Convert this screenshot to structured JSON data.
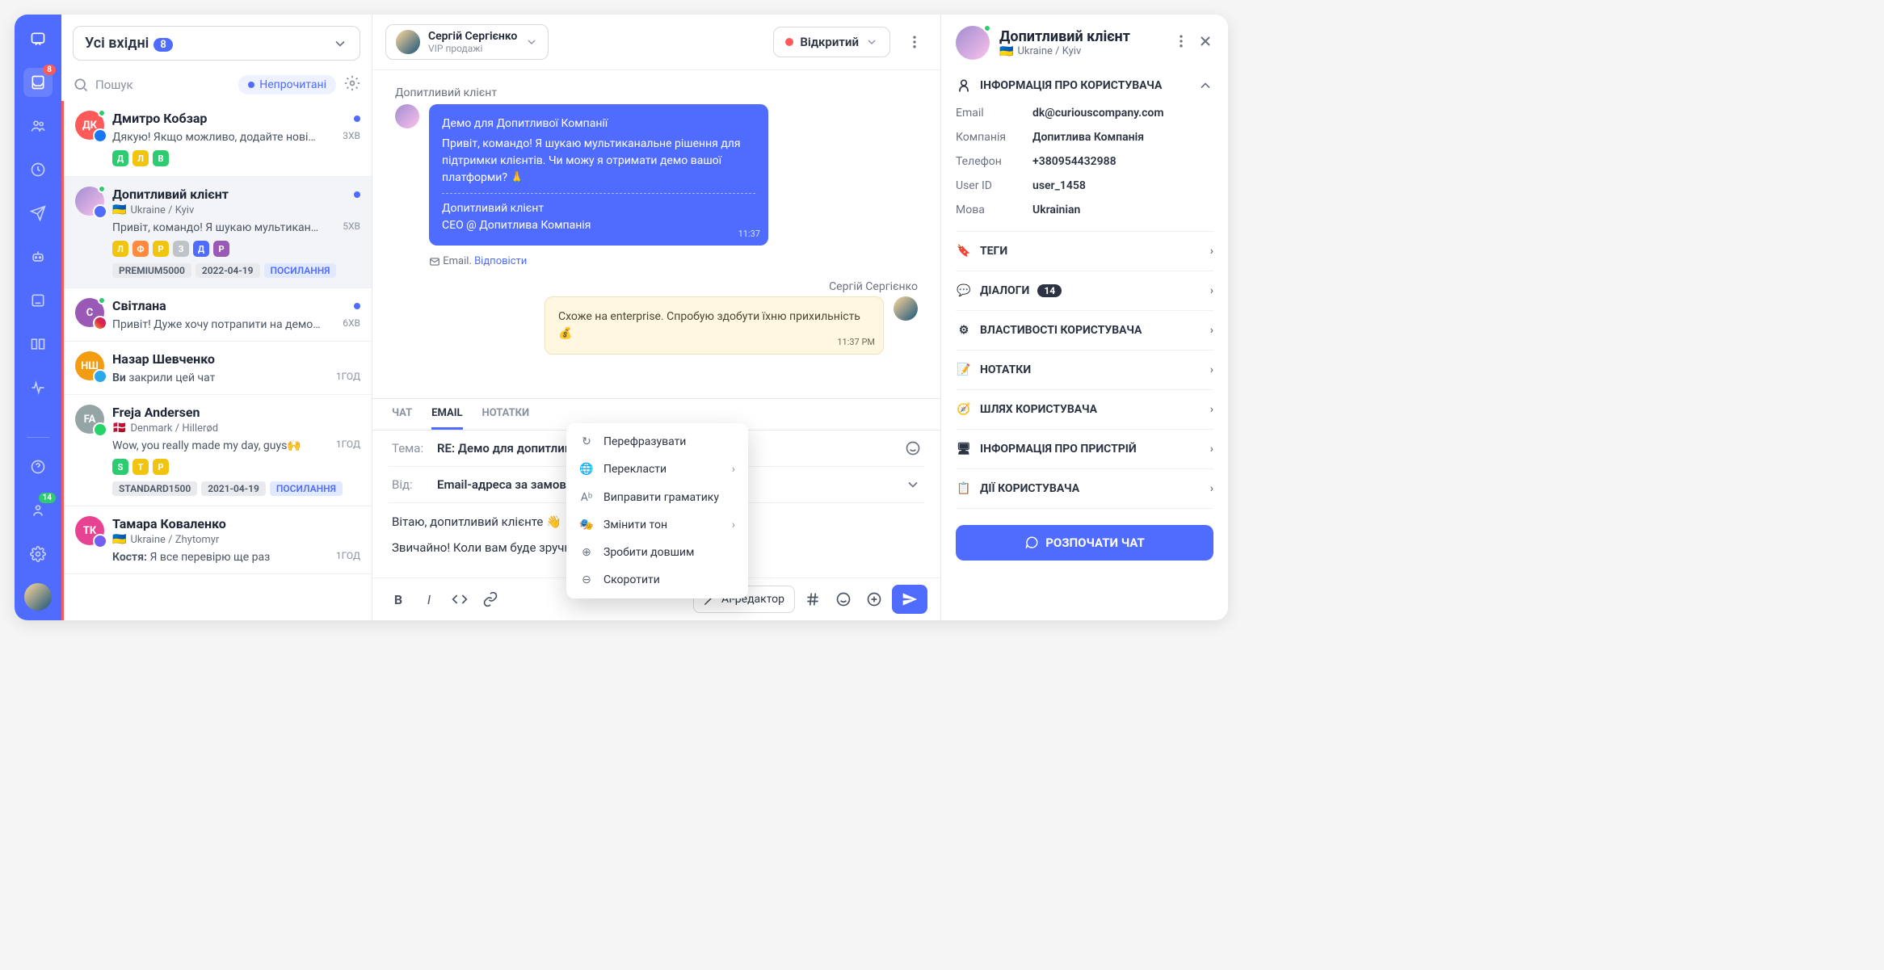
{
  "nav": {
    "inbox_badge": "8",
    "team_badge": "14"
  },
  "inbox": {
    "label": "Усі вхідні",
    "count": "8"
  },
  "search": {
    "placeholder": "Пошук",
    "filter": "Непрочитані"
  },
  "conversations": [
    {
      "name": "Дмитро Кобзар",
      "preview": "Дякую! Якщо можливо, додайте нові…",
      "time": "3ХВ",
      "initials": "ДК",
      "avatar_bg": "#ff5a5a",
      "channel_bg": "#1877f2",
      "online": true,
      "tags": [
        {
          "l": "Д",
          "c": "#2ecc71"
        },
        {
          "l": "Л",
          "c": "#f1c40f"
        },
        {
          "l": "В",
          "c": "#2ecc71"
        }
      ]
    },
    {
      "name": "Допитливий клієнт",
      "preview": "Привіт, командо! Я шукаю мультикан…",
      "time": "5ХВ",
      "loc": "Ukraine / Kyiv",
      "flag": "🇺🇦",
      "avatar_img": true,
      "channel_bg": "#4f6cff",
      "online": true,
      "tags": [
        {
          "l": "Л",
          "c": "#f1c40f"
        },
        {
          "l": "Ф",
          "c": "#ff8a3d"
        },
        {
          "l": "Р",
          "c": "#f1c40f"
        },
        {
          "l": "З",
          "c": "#bdc3c7"
        },
        {
          "l": "Д",
          "c": "#4f6cff"
        },
        {
          "l": "Р",
          "c": "#9b59b6"
        }
      ],
      "pills": [
        "PREMIUM5000",
        "2022-04-19"
      ],
      "link_pill": "ПОСИЛАННЯ",
      "selected": true
    },
    {
      "name": "Світлана",
      "preview": "Привіт! Дуже хочу потрапити на демо…",
      "time": "6ХВ",
      "initials": "С",
      "avatar_bg": "#9b59b6",
      "channel_bg": "linear-gradient(45deg,#f09433,#e6683c,#dc2743,#cc2366,#bc1888)",
      "online": true
    },
    {
      "name": "Назар Шевченко",
      "preview_prefix": "Ви ",
      "preview": "закрили цей чат",
      "time": "1ГОД",
      "initials": "НШ",
      "avatar_bg": "#f39c12",
      "channel_bg": "#29a9eb"
    },
    {
      "name": "Freja Andersen",
      "preview": "Wow, you really made my day, guys🙌",
      "time": "1ГОД",
      "initials": "FA",
      "avatar_bg": "#95a5a6",
      "channel_bg": "#25d366",
      "loc": "Denmark / Hillerød",
      "flag": "🇩🇰",
      "tags": [
        {
          "l": "S",
          "c": "#2ecc71"
        },
        {
          "l": "T",
          "c": "#f1c40f"
        },
        {
          "l": "P",
          "c": "#f1c40f"
        }
      ],
      "pills": [
        "STANDARD1500",
        "2021-04-19"
      ],
      "link_pill": "ПОСИЛАННЯ"
    },
    {
      "name": "Тамара Коваленко",
      "preview_prefix": "Костя: ",
      "preview": "Я все перевірю ще раз",
      "time": "1ГОД",
      "initials": "ТК",
      "avatar_bg": "#e84393",
      "channel_bg": "#7360f2",
      "loc": "Ukraine / Zhytomyr",
      "flag": "🇺🇦"
    }
  ],
  "chat_header": {
    "assignee_name": "Сергій Сергієнко",
    "assignee_role": "VIP продажі",
    "status": "Відкритий"
  },
  "messages": {
    "in_label": "Допитливий клієнт",
    "in_lines": [
      "Демо для Допитливої Компанії",
      "Привіт, командо! Я шукаю мультиканальне рішення для підтримки клієнтів. Чи можу я отримати демо вашої платформи? 🙏"
    ],
    "in_sig": [
      "Допитливий клієнт",
      "CEO @ Допитлива Компанія"
    ],
    "in_time": "11:37",
    "email_meta_prefix": "Email. ",
    "email_meta_link": "Відповісти",
    "out_label": "Сергій Сергієнко",
    "out_text": "Схоже на enterprise. Спробую здобути їхню прихильність 💰",
    "out_time": "11:37 PM"
  },
  "composer": {
    "tabs": [
      "ЧАТ",
      "EMAIL",
      "НОТАТКИ"
    ],
    "subject_label": "Тема:",
    "subject": "RE: Демо для допитливого к",
    "from_label": "Від:",
    "from": "Email-адреса за замовчуван",
    "body_line1": "Вітаю, допитливий клієнте 👋",
    "body_line2": "Звичайно! Коли вам буде зручно?",
    "ai_button": "AI-редактор"
  },
  "ai_menu": [
    "Перефразувати",
    "Перекласти",
    "Виправити граматику",
    "Змінити тон",
    "Зробити довшим",
    "Скоротити"
  ],
  "details": {
    "name": "Допитливий клієнт",
    "loc": "Ukraine / Kyiv",
    "flag": "🇺🇦",
    "section_user_info": "ІНФОРМАЦІЯ ПРО КОРИСТУВАЧА",
    "info": [
      {
        "k": "Email",
        "v": "dk@curiouscompany.com"
      },
      {
        "k": "Компанія",
        "v": "Допитлива Компанія"
      },
      {
        "k": "Телефон",
        "v": "+380954432988"
      },
      {
        "k": "User ID",
        "v": "user_1458"
      },
      {
        "k": "Мова",
        "v": "Ukrainian"
      }
    ],
    "sections": [
      {
        "label": "ТЕГИ"
      },
      {
        "label": "ДІАЛОГИ",
        "count": "14"
      },
      {
        "label": "ВЛАСТИВОСТІ КОРИСТУВАЧА"
      },
      {
        "label": "НОТАТКИ"
      },
      {
        "label": "ШЛЯХ КОРИСТУВАЧА"
      },
      {
        "label": "ІНФОРМАЦІЯ ПРО ПРИСТРІЙ"
      },
      {
        "label": "ДІЇ КОРИСТУВАЧА"
      }
    ],
    "start_chat": "РОЗПОЧАТИ ЧАТ"
  }
}
